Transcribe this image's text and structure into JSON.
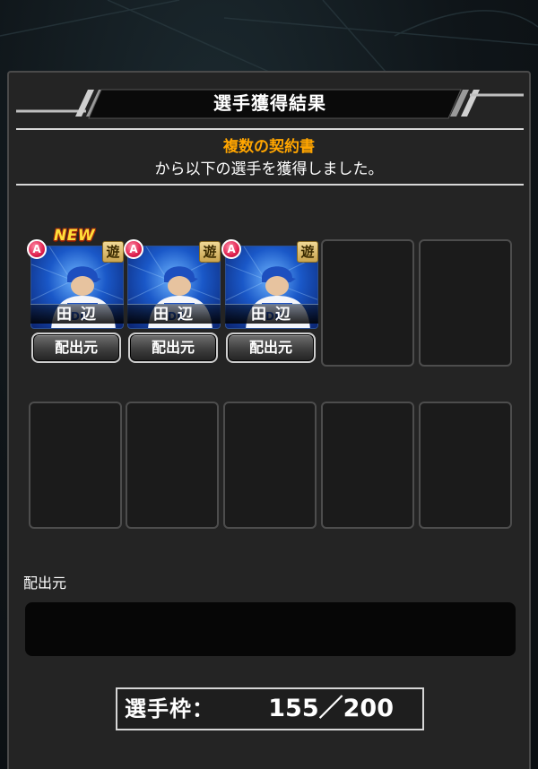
{
  "dialog": {
    "title": "選手獲得結果",
    "contract_name": "複数の契約書",
    "message": "から以下の選手を獲得しました。"
  },
  "players": [
    {
      "rank": "A",
      "position": "遊",
      "name": "田 辺",
      "is_new": true,
      "new_label": "NEW",
      "source_button": "配出元"
    },
    {
      "rank": "A",
      "position": "遊",
      "name": "田 辺",
      "is_new": false,
      "source_button": "配出元"
    },
    {
      "rank": "A",
      "position": "遊",
      "name": "田 辺",
      "is_new": false,
      "source_button": "配出元"
    }
  ],
  "source_section": {
    "label": "配出元",
    "value": ""
  },
  "roster": {
    "label": "選手枠：",
    "count": "155／200"
  },
  "colors": {
    "accent": "#ffa500",
    "panel_bg": "#242424",
    "rank_badge": "#e0214f",
    "position_badge": "#d9b965"
  }
}
